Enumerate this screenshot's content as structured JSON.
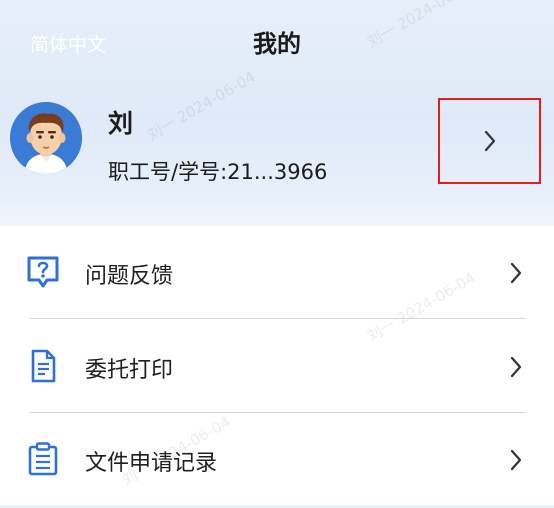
{
  "header": {
    "language_label": "简体中文",
    "title": "我的"
  },
  "profile": {
    "name": "刘",
    "id_line": "职工号/学号:21...3966"
  },
  "menu": [
    {
      "label": "问题反馈",
      "icon": "question-feedback-icon"
    },
    {
      "label": "委托打印",
      "icon": "document-icon"
    },
    {
      "label": "文件申请记录",
      "icon": "clipboard-list-icon"
    }
  ],
  "watermark": {
    "text": "刘一 2024-06-04"
  },
  "colors": {
    "accent": "#2f6fd8",
    "highlight_box": "#e21f1f"
  }
}
